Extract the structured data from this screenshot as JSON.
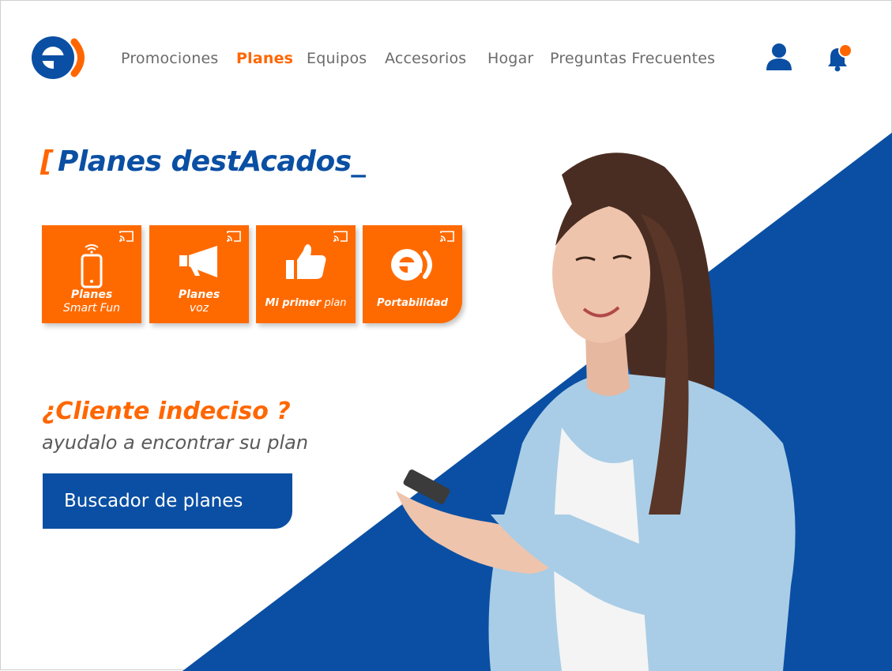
{
  "brand": {
    "name": "entel",
    "colors": {
      "primary": "#0a4fa3",
      "accent": "#ff6600",
      "card": "#ff6a00"
    }
  },
  "nav": {
    "items": [
      {
        "label": "Promociones",
        "active": false
      },
      {
        "label": "Planes",
        "active": true
      },
      {
        "label": "Equipos",
        "active": false
      },
      {
        "label": "Accesorios",
        "active": false
      },
      {
        "label": "Hogar",
        "active": false
      },
      {
        "label": "Preguntas Frecuentes",
        "active": false
      }
    ]
  },
  "header_icons": {
    "user": "user-icon",
    "notifications": "bell-icon",
    "has_notification": true
  },
  "section": {
    "bracket": "[",
    "title": "Planes destAcados_"
  },
  "cards": [
    {
      "icon": "smartphone-icon",
      "line1": "Planes",
      "line2": "Smart Fun"
    },
    {
      "icon": "megaphone-icon",
      "line1": "Planes",
      "line2": "voz"
    },
    {
      "icon": "thumbs-up-icon",
      "bold": "Mi primer",
      "light": " plan"
    },
    {
      "icon": "entel-logo-icon",
      "bold": "Portabilidad"
    }
  ],
  "promo": {
    "title": "¿Cliente indeciso ?",
    "subtitle": "ayudalo a encontrar su plan",
    "button": "Buscador de planes"
  }
}
